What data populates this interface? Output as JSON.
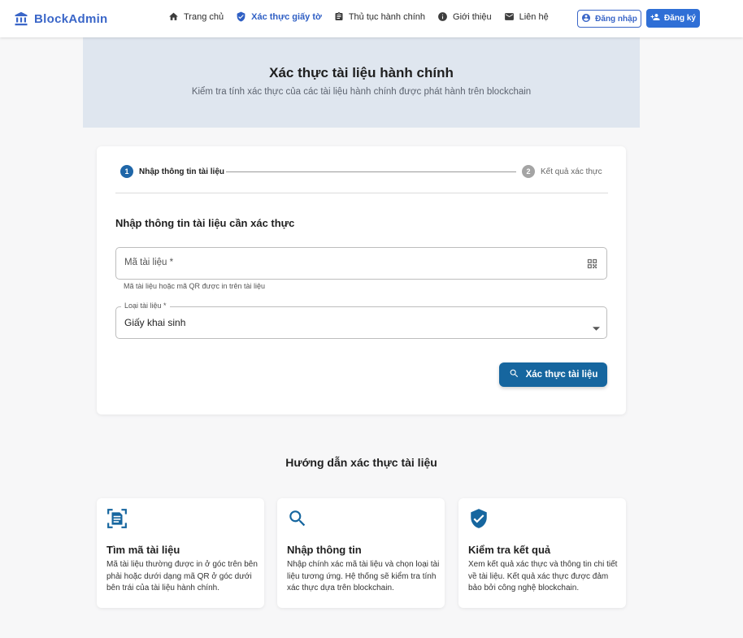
{
  "brand": {
    "name": "BlockAdmin",
    "color": "#3a66c8"
  },
  "nav": {
    "items": [
      {
        "label": "Trang chủ",
        "icon": "home-icon",
        "active": false
      },
      {
        "label": "Xác thực giấy tờ",
        "icon": "verified-shield-icon",
        "active": true
      },
      {
        "label": "Thủ tục hành chính",
        "icon": "document-icon",
        "active": false
      },
      {
        "label": "Giới thiệu",
        "icon": "info-icon",
        "active": false
      },
      {
        "label": "Liên hệ",
        "icon": "mail-icon",
        "active": false
      }
    ],
    "login_label": "Đăng nhập",
    "register_label": "Đăng ký"
  },
  "hero": {
    "title": "Xác thực tài liệu hành chính",
    "subtitle": "Kiểm tra tính xác thực của các tài liệu hành chính được phát hành trên blockchain"
  },
  "stepper": {
    "steps": [
      {
        "number": "1",
        "label": "Nhập thông tin tài liệu",
        "active": true
      },
      {
        "number": "2",
        "label": "Kết quả xác thực",
        "active": false
      }
    ]
  },
  "form": {
    "section_title": "Nhập thông tin tài liệu cần xác thực",
    "code_field": {
      "placeholder": "Mã tài liệu *",
      "helper": "Mã tài liệu hoặc mã QR được in trên tài liệu"
    },
    "type_field": {
      "label": "Loại tài liệu *",
      "value": "Giấy khai sinh"
    },
    "submit_label": "Xác thực tài liệu"
  },
  "guide": {
    "title": "Hướng dẫn xác thực tài liệu",
    "cards": [
      {
        "icon": "document-scan-icon",
        "title": "Tìm mã tài liệu",
        "description": "Mã tài liệu thường được in ở góc trên bên phải hoặc dưới dạng mã QR ở góc dưới bên trái của tài liệu hành chính."
      },
      {
        "icon": "search-icon",
        "title": "Nhập thông tin",
        "description": "Nhập chính xác mã tài liệu và chọn loại tài liệu tương ứng. Hệ thống sẽ kiểm tra tính xác thực dựa trên blockchain."
      },
      {
        "icon": "verified-shield-icon",
        "title": "Kiểm tra kết quả",
        "description": "Xem kết quả xác thực và thông tin chi tiết về tài liệu. Kết quả xác thực được đảm bảo bởi công nghệ blockchain."
      }
    ]
  },
  "colors": {
    "primary": "#16669f",
    "accent": "#2f6fd6",
    "hero_bg": "#dfe6ef",
    "page_bg": "#f7f7f8"
  }
}
